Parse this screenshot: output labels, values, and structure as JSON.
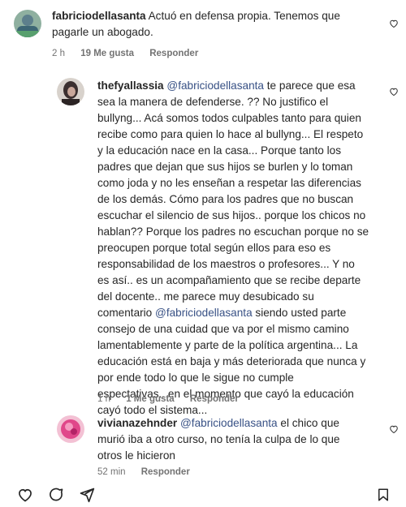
{
  "comments": [
    {
      "username": "fabriciodellasanta",
      "text": " Actuó en defensa propia. Tenemos que\npagarle un abogado.",
      "time": "2 h",
      "likes": "19 Me gusta",
      "reply": "Responder"
    },
    {
      "username": "thefyallassia",
      "mention": "@fabriciodellasanta",
      "text_before": " ",
      "text_after": " te parece que esa\nsea la manera de defenderse. ?? No justifico el\nbullyng... Acá somos todos culpables tanto para quien\nrecibe como para quien lo hace al bullyng... El respeto\ny la educación nace en la casa... Porque tanto los\npadres que dejan que sus hijos se burlen y lo toman\ncomo joda y no les enseñan a respetar las diferencias\nde los demás. Cómo para los padres que no buscan\nescuchar el silencio de sus hijos.. porque los chicos no\nhablan?? Porque los padres no escuchan porque no se\npreocupen porque total según ellos para eso es\nresponsabilidad de los maestros o profesores... Y no\nes así.. es un acompañamiento que se recibe departe\ndel docente.. me parece muy desubicado su\ncomentario ",
      "mention2": "@fabriciodellasanta",
      "text_end": " siendo usted parte\nconsejo de una cuidad que va por el mismo camino\nlamentablemente y parte de la política argentina... La\neducación está en baja y más deteriorada que nunca y\npor ende todo lo que le sigue no cumple\nespectativas.. en el momento que cayó la educación\ncayó todo el sistema...",
      "time": "1 h",
      "likes": "1 Me gusta",
      "reply": "Responder"
    },
    {
      "username": "vivianazehnder",
      "mention": "@fabriciodellasanta",
      "text_after": " el chico que\nmurió iba a otro curso, no tenía la culpa de lo que\notros le hicieron",
      "time": "52 min",
      "reply": "Responder"
    }
  ],
  "icons": {
    "heart": "heart-icon",
    "like_post": "heart-outline-icon",
    "comment_post": "comment-icon",
    "share_post": "paper-plane-icon",
    "save_post": "bookmark-icon"
  }
}
